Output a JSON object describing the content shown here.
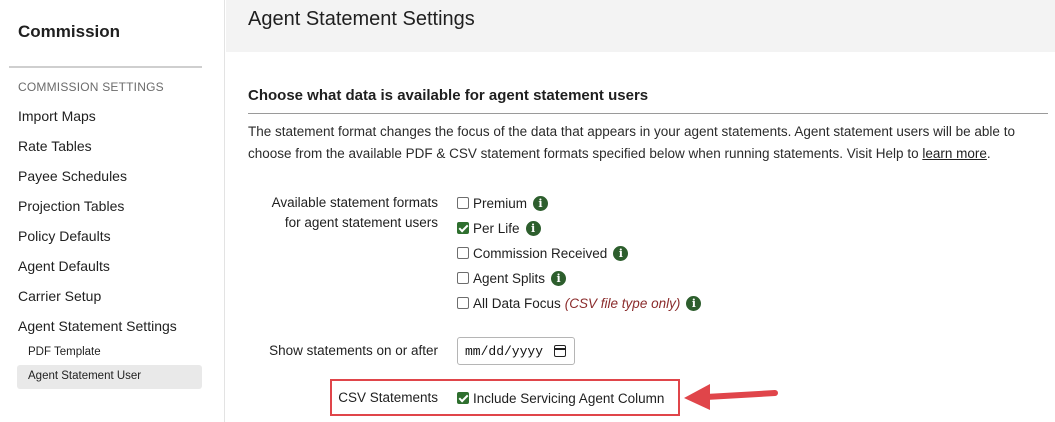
{
  "sidebar": {
    "title": "Commission",
    "section_label": "COMMISSION SETTINGS",
    "items": [
      {
        "label": "Import Maps"
      },
      {
        "label": "Rate Tables"
      },
      {
        "label": "Payee Schedules"
      },
      {
        "label": "Projection Tables"
      },
      {
        "label": "Policy Defaults"
      },
      {
        "label": "Agent Defaults"
      },
      {
        "label": "Carrier Setup"
      },
      {
        "label": "Agent Statement Settings"
      }
    ],
    "subitems": [
      {
        "label": "PDF Template"
      },
      {
        "label": "Agent Statement User",
        "active": true
      }
    ]
  },
  "header": {
    "title": "Agent Statement Settings"
  },
  "main": {
    "heading": "Choose what data is available for agent statement users",
    "description": "The statement format changes the focus of the data that appears in your agent statements. Agent statement users will be able to choose from the available PDF & CSV statement formats specified below when running statements. Visit Help to ",
    "learn_more": "learn more",
    "description_end": ".",
    "formats": {
      "label_line1": "Available statement formats",
      "label_line2": "for agent statement users",
      "options": [
        {
          "label": "Premium",
          "checked": false
        },
        {
          "label": "Per Life",
          "checked": true
        },
        {
          "label": "Commission Received",
          "checked": false
        },
        {
          "label": "Agent Splits",
          "checked": false
        },
        {
          "label": "All Data Focus",
          "checked": false,
          "note": "(CSV file type only)"
        }
      ]
    },
    "date": {
      "label": "Show statements on or after",
      "placeholder": "mm/dd/yyyy"
    },
    "csv": {
      "label": "CSV Statements",
      "option_label": "Include Servicing Agent Column",
      "checked": true
    }
  },
  "colors": {
    "accent_green": "#2e6f2e",
    "highlight_red": "#e0454a",
    "note_red": "#8a2b2b"
  }
}
